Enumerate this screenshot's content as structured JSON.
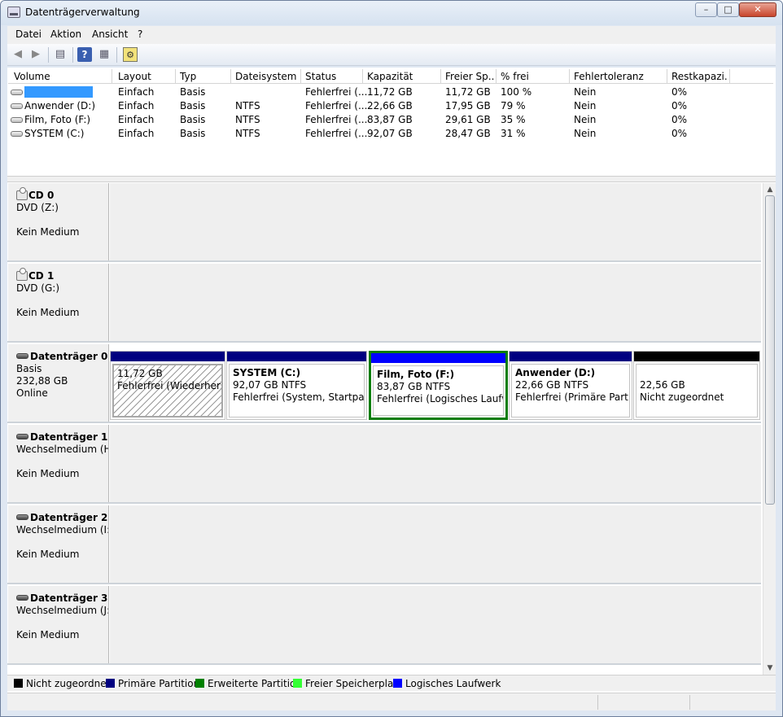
{
  "window": {
    "title": "Datenträgerverwaltung",
    "controls": {
      "minimize": "–",
      "maximize": "□",
      "close": "✕"
    }
  },
  "menu": [
    {
      "label": "Datei"
    },
    {
      "label": "Aktion"
    },
    {
      "label": "Ansicht"
    },
    {
      "label": "?"
    }
  ],
  "toolbar": {
    "icons": [
      "back-arrow-icon",
      "forward-arrow-icon",
      "disk-list-icon",
      "help-icon",
      "properties-icon",
      "settings-icon"
    ]
  },
  "volumes": {
    "columns": [
      "Volume",
      "Layout",
      "Typ",
      "Dateisystem",
      "Status",
      "Kapazität",
      "Freier Sp...",
      "% frei",
      "Fehlertoleranz",
      "Restkapazi..."
    ],
    "rows": [
      {
        "volume": "",
        "layout": "Einfach",
        "typ": "Basis",
        "fs": "",
        "status": "Fehlerfrei (...",
        "kap": "11,72 GB",
        "frei": "11,72 GB",
        "pct": "100 %",
        "fehler": "Nein",
        "rest": "0%"
      },
      {
        "volume": "Anwender (D:)",
        "layout": "Einfach",
        "typ": "Basis",
        "fs": "NTFS",
        "status": "Fehlerfrei (...",
        "kap": "22,66 GB",
        "frei": "17,95 GB",
        "pct": "79 %",
        "fehler": "Nein",
        "rest": "0%"
      },
      {
        "volume": "Film, Foto (F:)",
        "layout": "Einfach",
        "typ": "Basis",
        "fs": "NTFS",
        "status": "Fehlerfrei (...",
        "kap": "83,87 GB",
        "frei": "29,61 GB",
        "pct": "35 %",
        "fehler": "Nein",
        "rest": "0%"
      },
      {
        "volume": "SYSTEM (C:)",
        "layout": "Einfach",
        "typ": "Basis",
        "fs": "NTFS",
        "status": "Fehlerfrei (...",
        "kap": "92,07 GB",
        "frei": "28,47 GB",
        "pct": "31 %",
        "fehler": "Nein",
        "rest": "0%"
      }
    ]
  },
  "disks": [
    {
      "name": "CD 0",
      "line1": "DVD (Z:)",
      "line2": "",
      "line3": "Kein Medium"
    },
    {
      "name": "CD 1",
      "line1": "DVD (G:)",
      "line2": "",
      "line3": "Kein Medium"
    },
    {
      "name": "Datenträger 0",
      "line1": "Basis",
      "line2": "232,88 GB",
      "line3": "Online"
    },
    {
      "name": "Datenträger 1",
      "line1": "Wechselmedium (H",
      "line2": "",
      "line3": "Kein Medium"
    },
    {
      "name": "Datenträger 2",
      "line1": "Wechselmedium (I:)",
      "line2": "",
      "line3": "Kein Medium"
    },
    {
      "name": "Datenträger 3",
      "line1": "Wechselmedium (J:)",
      "line2": "",
      "line3": "Kein Medium"
    }
  ],
  "partitions": [
    {
      "name": "",
      "size": "11,72 GB",
      "status": "Fehlerfrei (Wiederherstel",
      "bar_color": "#000080"
    },
    {
      "name": "SYSTEM  (C:)",
      "size": "92,07 GB NTFS",
      "status": "Fehlerfrei (System, Startpartitio",
      "bar_color": "#000080"
    },
    {
      "name": "Film, Foto  (F:)",
      "size": "83,87 GB NTFS",
      "status": "Fehlerfrei (Logisches Laufwe",
      "bar_color": "#0000ff"
    },
    {
      "name": "Anwender  (D:)",
      "size": "22,66 GB NTFS",
      "status": "Fehlerfrei (Primäre Partitio",
      "bar_color": "#000080"
    },
    {
      "name": "",
      "size": "22,56 GB",
      "status": "Nicht zugeordnet",
      "bar_color": "#000000"
    }
  ],
  "legend": [
    {
      "label": "Nicht zugeordnet",
      "color": "#000000"
    },
    {
      "label": "Primäre Partition",
      "color": "#000080"
    },
    {
      "label": "Erweiterte Partition",
      "color": "#008000"
    },
    {
      "label": "Freier Speicherplatz",
      "color": "#33ff33"
    },
    {
      "label": "Logisches Laufwerk",
      "color": "#0000ff"
    }
  ]
}
